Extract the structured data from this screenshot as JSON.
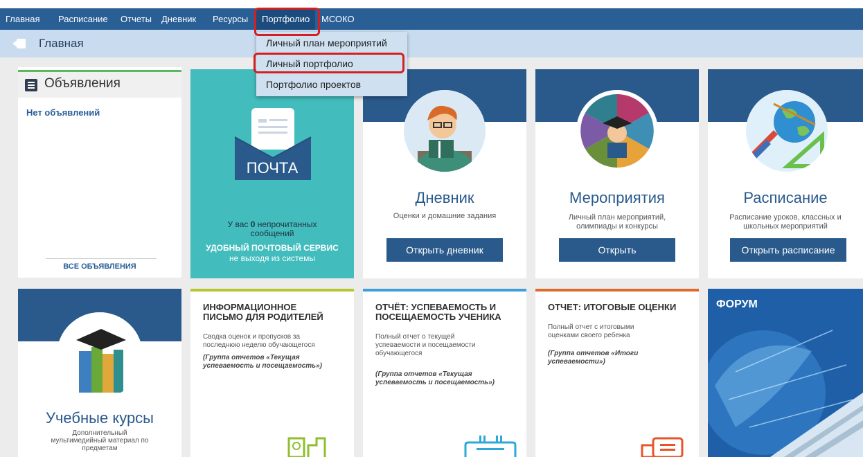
{
  "nav": {
    "items": [
      "Главная",
      "Расписание",
      "Отчеты",
      "Дневник",
      "Ресурсы",
      "Портфолио",
      "МСОКО"
    ]
  },
  "breadcrumb": {
    "title": "Главная"
  },
  "dropdown": {
    "items": [
      "Личный план мероприятий",
      "Личный портфолио",
      "Портфолио проектов"
    ]
  },
  "announcements": {
    "title": "Объявления",
    "empty": "Нет объявлений",
    "all_link": "ВСЕ ОБЪЯВЛЕНИЯ"
  },
  "mail": {
    "logo_text": "ПОЧТА",
    "unread_prefix": "У вас ",
    "unread_count": "0",
    "unread_suffix": " непрочитанных",
    "unread_line2": "сообщений",
    "service_title": "УДОБНЫЙ ПОЧТОВЫЙ СЕРВИС",
    "service_sub": "не выходя из системы"
  },
  "tiles": {
    "diary": {
      "title": "Дневник",
      "sub": "Оценки и домашние задания",
      "button": "Открыть дневник"
    },
    "events": {
      "title": "Мероприятия",
      "sub_line1": "Личный план мероприятий,",
      "sub_line2": "олимпиады и конкурсы",
      "button": "Открыть"
    },
    "schedule": {
      "title": "Расписание",
      "sub_line1": "Расписание уроков, классных и",
      "sub_line2": "школьных мероприятий",
      "button": "Открыть расписание"
    },
    "courses": {
      "title": "Учебные курсы",
      "sub_line1": "Дополнительный",
      "sub_line2": "мультимедийный материал по",
      "sub_line3": "предметам"
    }
  },
  "reports": {
    "info": {
      "title_line1": "ИНФОРМАЦИОННОЕ",
      "title_line2": "ПИСЬМО ДЛЯ РОДИТЕЛЕЙ",
      "desc_line1": "Сводка оценок и пропусков за",
      "desc_line2": "последнюю неделю обучающегося",
      "group_line1": "(Группа отчетов «Текущая",
      "group_line2": "успеваемость и посещаемость»)"
    },
    "attendance": {
      "title_line1": "ОТЧЁТ: УСПЕВАЕМОСТЬ И",
      "title_line2": "ПОСЕЩАЕМОСТЬ УЧЕНИКА",
      "desc_line1": "Полный отчет о текущей",
      "desc_line2": "успеваемости и посещаемости",
      "desc_line3": "обучающегося",
      "group_line1": "(Группа отчетов «Текущая",
      "group_line2": "успеваемость и посещаемость»)"
    },
    "final": {
      "title_line1": "ОТЧЕТ: ИТОГОВЫЕ ОЦЕНКИ",
      "desc_line1": "Полный отчет с итоговыми",
      "desc_line2": "оценками своего ребенка",
      "group_line1": "(Группа отчетов «Итоги",
      "group_line2": "успеваемости»)"
    }
  },
  "forum": {
    "title": "ФОРУМ"
  },
  "colors": {
    "nav": "#2a5f96",
    "tile_band": "#2a5a8c",
    "mail": "#42bcbc",
    "highlight": "#d42020",
    "report_yellow": "#b7c62a",
    "report_blue": "#3fa0d8",
    "report_orange": "#e06a2c"
  }
}
